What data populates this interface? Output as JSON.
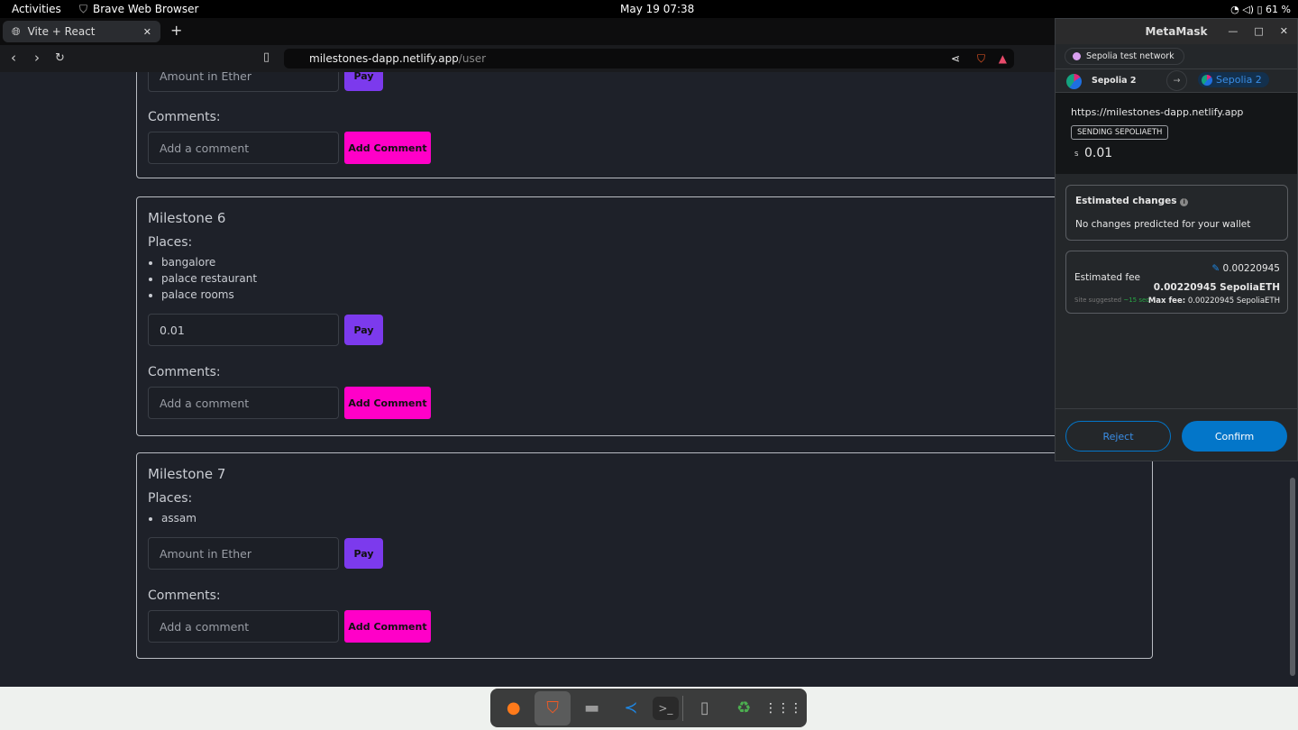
{
  "system": {
    "activities": "Activities",
    "app_name": "Brave Web Browser",
    "clock": "May 19  07:38",
    "battery": "61 %"
  },
  "browser": {
    "tab_title": "Vite + React",
    "url_host": "milestones-dapp.netlify.app",
    "url_path": "/user"
  },
  "milestones": [
    {
      "title": "",
      "places": [],
      "amount_placeholder": "Amount in Ether",
      "amount_value": "",
      "pay": "Pay",
      "comments_label": "Comments:",
      "comment_placeholder": "Add a comment",
      "add_comment": "Add Comment"
    },
    {
      "title": "Milestone 6",
      "places_label": "Places:",
      "places": [
        "bangalore",
        "palace restaurant",
        "palace rooms"
      ],
      "amount_placeholder": "Amount in Ether",
      "amount_value": "0.01",
      "pay": "Pay",
      "comments_label": "Comments:",
      "comment_placeholder": "Add a comment",
      "add_comment": "Add Comment"
    },
    {
      "title": "Milestone 7",
      "places_label": "Places:",
      "places": [
        "assam"
      ],
      "amount_placeholder": "Amount in Ether",
      "amount_value": "",
      "pay": "Pay",
      "comments_label": "Comments:",
      "comment_placeholder": "Add a comment",
      "add_comment": "Add Comment"
    }
  ],
  "metamask": {
    "title": "MetaMask",
    "network": "Sepolia test network",
    "from_account": "Sepolia 2",
    "to_account": "Sepolia 2",
    "origin": "https://milestones-dapp.netlify.app",
    "action_badge": "SENDING SEPOLIAETH",
    "amount_symbol": "S",
    "amount": "0.01",
    "estimated_changes_title": "Estimated changes",
    "estimated_changes_text": "No changes predicted for your wallet",
    "fee_label": "Estimated fee",
    "fee_value": "0.00220945",
    "fee_total": "0.00220945 SepoliaETH",
    "site_suggested": "Site suggested",
    "time": "~15 sec",
    "max_fee_label": "Max fee:",
    "max_fee_value": "0.00220945 SepoliaETH",
    "reject": "Reject",
    "confirm": "Confirm",
    "accent": "#0376c9"
  },
  "dock": [
    "firefox-icon",
    "brave-icon",
    "files-icon",
    "vscode-icon",
    "terminal-icon",
    "device-icon",
    "trash-icon",
    "app-grid-icon"
  ]
}
